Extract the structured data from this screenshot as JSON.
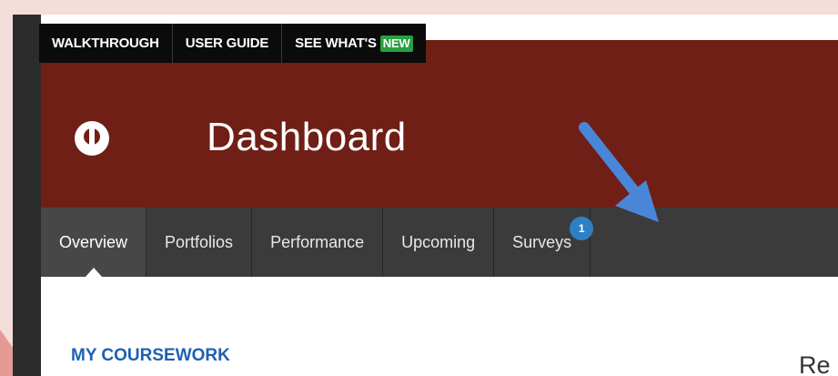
{
  "topbar": {
    "walkthrough": "WALKTHROUGH",
    "user_guide": "USER GUIDE",
    "see_whats": "SEE WHAT'S",
    "new_badge": "NEW"
  },
  "header": {
    "title": "Dashboard",
    "logo_icon": "keyhole-logo-icon"
  },
  "tabs": [
    {
      "label": "Overview",
      "active": true
    },
    {
      "label": "Portfolios"
    },
    {
      "label": "Performance"
    },
    {
      "label": "Upcoming"
    },
    {
      "label": "Surveys",
      "badge": "1"
    }
  ],
  "main": {
    "section_title": "MY COURSEWORK",
    "partial_heading": "Re"
  },
  "annotation": {
    "icon": "pointer-arrow-icon",
    "color": "#4a86d8"
  },
  "colors": {
    "header_bg": "#6f1f16",
    "tabbar_bg": "#3b3b3b",
    "badge_blue": "#2f7fc4",
    "new_green": "#27a043",
    "section_blue": "#1e60b0"
  }
}
